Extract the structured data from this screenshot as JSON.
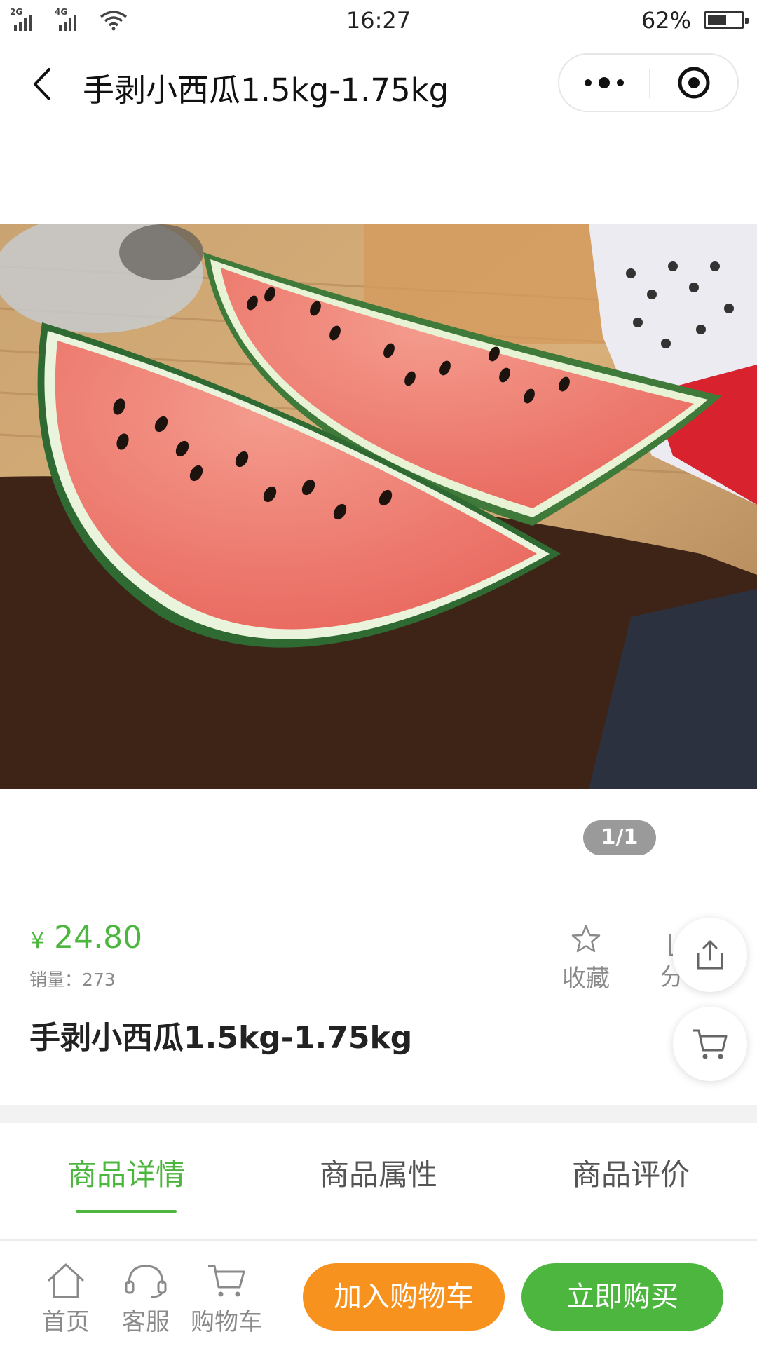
{
  "status_bar": {
    "signal1": "2G",
    "signal2": "4G",
    "time": "16:27",
    "battery_percent": "62%",
    "battery_level": 0.62
  },
  "nav": {
    "title": "手剥小西瓜1.5kg-1.75kg",
    "back_icon": "chevron-left-icon",
    "more_icon": "more-dots-icon",
    "close_icon": "target-circle-icon"
  },
  "gallery": {
    "pager": "1/1",
    "image_subject": "watermelon slices"
  },
  "product": {
    "currency": "¥",
    "price": "24.80",
    "sales": "销量：273",
    "name": "手剥小西瓜1.5kg-1.75kg",
    "favorite_label": "收藏",
    "share_label": "分享"
  },
  "tabs": [
    {
      "label": "商品详情",
      "active": true
    },
    {
      "label": "商品属性",
      "active": false
    },
    {
      "label": "商品评价",
      "active": false
    }
  ],
  "bottom_bar": {
    "home_label": "首页",
    "service_label": "客服",
    "cart_label": "购物车",
    "add_to_cart_label": "加入购物车",
    "buy_now_label": "立即购买"
  },
  "colors": {
    "accent_green": "#4cb63f",
    "orange": "#f7921e",
    "muted": "#8a8a8a"
  }
}
